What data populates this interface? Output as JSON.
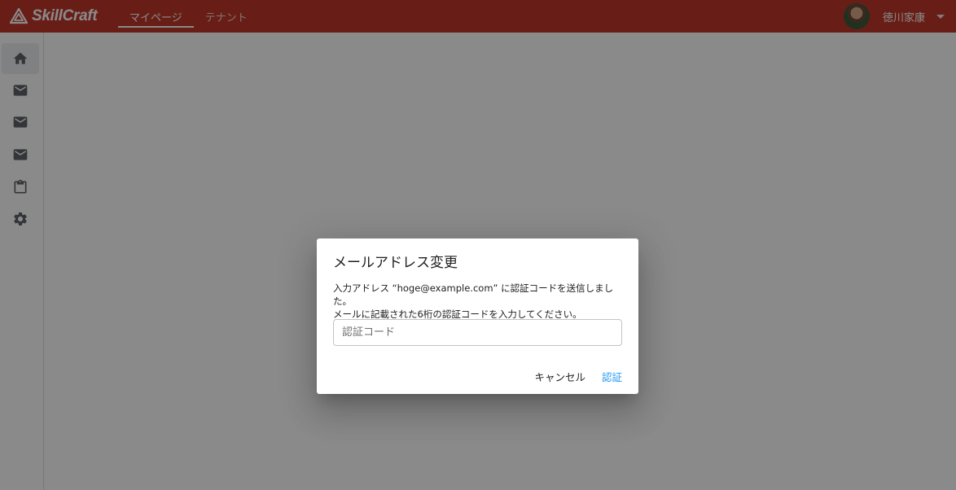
{
  "app": {
    "brand": "SkillCraft",
    "accent_color": "#c0392b",
    "tabs": [
      {
        "label": "マイページ",
        "active": true
      },
      {
        "label": "テナント",
        "active": false
      }
    ],
    "user": {
      "name": "徳川家康"
    }
  },
  "sidebar": {
    "items": [
      {
        "icon": "home-icon",
        "active": true
      },
      {
        "icon": "mail-icon",
        "active": false
      },
      {
        "icon": "mail-icon",
        "active": false
      },
      {
        "icon": "mail-icon",
        "active": false
      },
      {
        "icon": "clipboard-icon",
        "active": false
      },
      {
        "icon": "gear-icon",
        "active": false
      }
    ]
  },
  "dialog": {
    "title": "メールアドレス変更",
    "message_line1": "入力アドレス “hoge@example.com” に認証コードを送信しました。",
    "message_line2": "メールに記載された6桁の認証コードを入力してください。",
    "code_placeholder": "認証コード",
    "code_value": "",
    "cancel_label": "キャンセル",
    "verify_label": "認証",
    "verify_color": "#2196f3"
  }
}
